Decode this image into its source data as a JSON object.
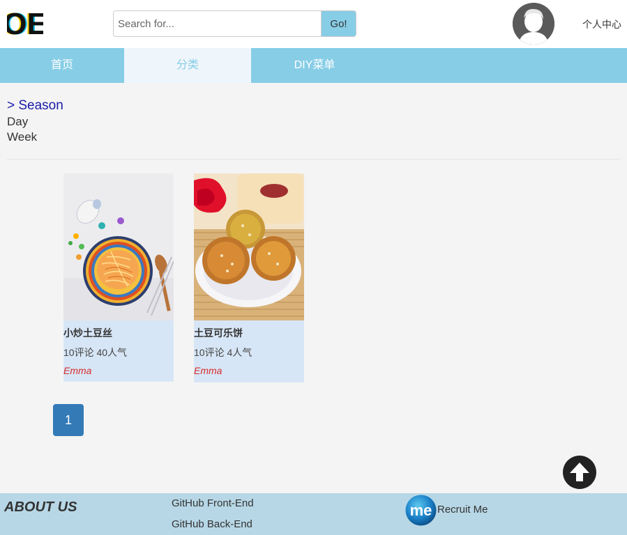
{
  "header": {
    "logo_text": "OE",
    "search": {
      "placeholder": "Search for...",
      "value": "",
      "button_label": "Go!"
    },
    "user_center_label": "个人中心"
  },
  "nav": {
    "items": [
      {
        "label": "首页",
        "active": false
      },
      {
        "label": "分类",
        "active": true
      },
      {
        "label": "DIY菜单",
        "active": false
      }
    ]
  },
  "filter": {
    "season_label": "> Season",
    "items": [
      "Day",
      "Week"
    ]
  },
  "cards": [
    {
      "title": "小炒土豆丝",
      "stats": "10评论 40人气",
      "author": "Emma",
      "image": "shredded-potato-dish"
    },
    {
      "title": "土豆可乐饼",
      "stats": "10评论 4人气",
      "author": "Emma",
      "image": "potato-croquettes-dish"
    }
  ],
  "pagination": {
    "current": "1"
  },
  "footer": {
    "about_label": "ABOUT US",
    "links": [
      "GitHub Front-End",
      "GitHub Back-End"
    ],
    "recruit_logo_text": "me",
    "recruit_label": "Recruit Me"
  },
  "colors": {
    "nav_bg": "#87cde6",
    "nav_active_bg": "#eef5fb",
    "card_bg": "#d7e6f6",
    "page_btn": "#337ab7",
    "footer_bg": "#b7d7e6",
    "author": "#d62d2d",
    "season_link": "#1a1aaa"
  },
  "icons": [
    "oe-logo-icon",
    "user-avatar-icon",
    "arrow-up-icon",
    "me-logo-icon"
  ]
}
